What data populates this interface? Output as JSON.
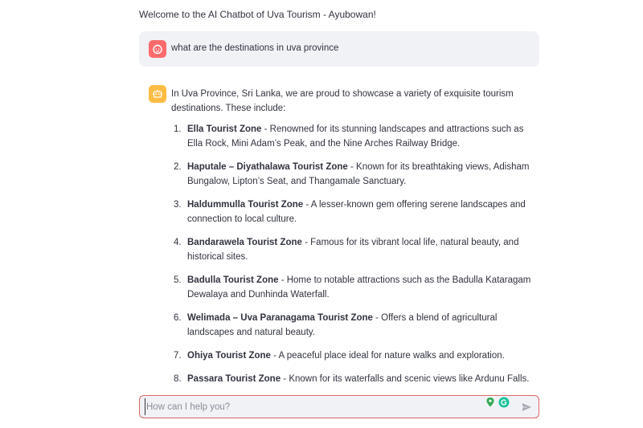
{
  "header": {
    "welcome_text": "Welcome to the AI Chatbot of Uva Tourism - Ayubowan!"
  },
  "user_message": {
    "text": "what are the destinations in uva province",
    "avatar_icon": "user-face-icon",
    "avatar_color": "#ff6b6b"
  },
  "bot_message": {
    "avatar_icon": "bot-icon",
    "avatar_color": "#ffbd45",
    "intro": "In Uva Province, Sri Lanka, we are proud to showcase a variety of exquisite tourism destinations. These include:",
    "items": [
      {
        "num": "1.",
        "name": "Ella Tourist Zone",
        "desc": " - Renowned for its stunning landscapes and attractions such as Ella Rock, Mini Adam’s Peak, and the Nine Arches Railway Bridge."
      },
      {
        "num": "2.",
        "name": "Haputale – Diyathalawa Tourist Zone",
        "desc": " - Known for its breathtaking views, Adisham Bungalow, Lipton’s Seat, and Thangamale Sanctuary."
      },
      {
        "num": "3.",
        "name": "Haldummulla Tourist Zone",
        "desc": " - A lesser-known gem offering serene landscapes and connection to local culture."
      },
      {
        "num": "4.",
        "name": "Bandarawela Tourist Zone",
        "desc": " - Famous for its vibrant local life, natural beauty, and historical sites."
      },
      {
        "num": "5.",
        "name": "Badulla Tourist Zone",
        "desc": " - Home to notable attractions such as the Badulla Kataragam Dewalaya and Dunhinda Waterfall."
      },
      {
        "num": "6.",
        "name": "Welimada – Uva Paranagama Tourist Zone",
        "desc": " - Offers a blend of agricultural landscapes and natural beauty."
      },
      {
        "num": "7.",
        "name": "Ohiya Tourist Zone",
        "desc": " - A peaceful place ideal for nature walks and exploration."
      },
      {
        "num": "8.",
        "name": "Passara Tourist Zone",
        "desc": " - Known for its waterfalls and scenic views like Ardunu Falls."
      }
    ]
  },
  "chat_input": {
    "placeholder": "How can I help you?",
    "value": "",
    "border_color": "#e06666",
    "send_icon": "send-arrow-icon",
    "extension_icons": [
      "location-pin-icon",
      "grammarly-icon"
    ]
  }
}
